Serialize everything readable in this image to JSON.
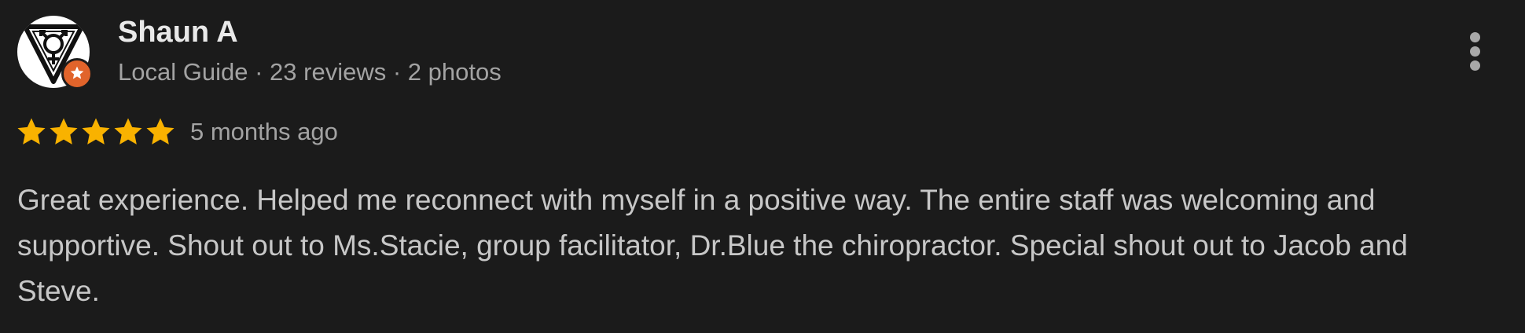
{
  "review": {
    "author": {
      "name": "Shaun A",
      "level": "Local Guide",
      "separator": "·",
      "reviews": "23 reviews",
      "photos": "2 photos",
      "avatar_icon": "triangle-gender-symbols-logo",
      "badge_icon": "local-guide-star-icon"
    },
    "rating": {
      "stars": 5,
      "max": 5,
      "date": "5 months ago"
    },
    "text": "Great experience. Helped me reconnect with myself in a positive way. The entire staff was welcoming and supportive. Shout out to Ms.Stacie, group facilitator, Dr.Blue the chiropractor. Special shout out to Jacob and Steve.",
    "menu_icon": "more-vert-icon"
  },
  "colors": {
    "background": "#1b1b1b",
    "star": "#f9b200",
    "badge": "#e1642b",
    "name": "#e9e9e9",
    "meta": "#a3a3a3",
    "body_text": "#c7c7c7"
  }
}
